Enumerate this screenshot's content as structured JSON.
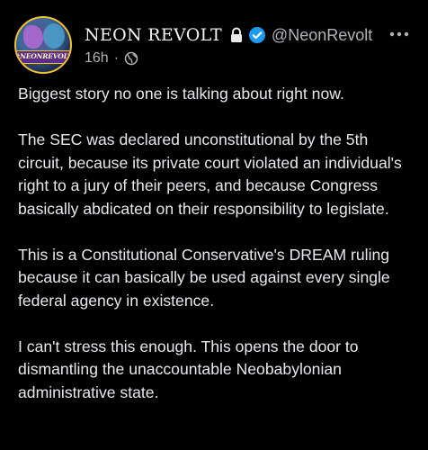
{
  "author": {
    "avatar_text": "#NEONREVOLT",
    "display_name": "NEON REVOLT",
    "handle": "@NeonRevolt",
    "timestamp": "16h",
    "separator": "·"
  },
  "icons": {
    "lock": "lock-icon",
    "verified": "verified-badge-icon",
    "visibility": "globe-icon",
    "more": "more-options-icon"
  },
  "colors": {
    "background": "#000000",
    "text": "#e7e9ea",
    "muted": "#b0b3b8",
    "verified": "#1d9bf0",
    "avatar_ring": "#f1c232"
  },
  "post": {
    "paragraphs": [
      "Biggest story no one is talking about right now.",
      "The SEC was declared unconstitutional by the 5th circuit, because its private court violated an individual's right to a jury of their peers, and because Congress basically abdicated on their responsibility to legislate.",
      "This is a Constitutional Conservative's DREAM ruling because it can basically be used against every single federal agency in existence.",
      "I can't stress this enough. This opens the door to dismantling the unaccountable Neobabylonian administrative state."
    ]
  }
}
